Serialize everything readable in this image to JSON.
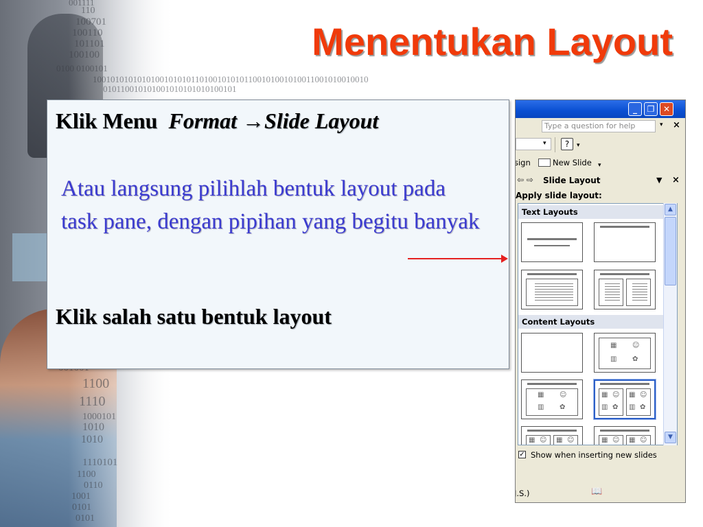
{
  "title": "Menentukan Layout",
  "binary_lines": [
    "001111",
    "110",
    "100701",
    "100110",
    "101101",
    "100100",
    "0100 0100101",
    "10010101010101001010101101001010101100101001010011001010010010",
    "010110010101001010101010100101",
    "001001",
    "1100",
    "1110",
    "1000101",
    "1010",
    "1010",
    "1110101",
    "1100",
    "0110",
    "1001",
    "0101",
    "0101"
  ],
  "instructions": {
    "line1_prefix": "Klik Menu",
    "line1_menu": "Format",
    "line1_arrow": "→",
    "line1_item": "Slide Layout",
    "paragraph": "Atau langsung pilihlah bentuk layout pada task pane, dengan pipihan yang begitu banyak",
    "line3": "Klik salah satu bentuk layout"
  },
  "colors": {
    "title": "#f03a0a",
    "paragraph": "#3b3bd0",
    "arrow": "#e52020",
    "titlebar": "#0a4fd2"
  },
  "window": {
    "buttons": {
      "minimize": "_",
      "restore": "❐",
      "close": "✕"
    },
    "help_placeholder": "Type a question for help",
    "help_dropdown": "▾",
    "help_close": "×",
    "combo_dropdown": "▾",
    "help_icon": "?",
    "help_icon_dropdown": "▾",
    "design_partial": "sign",
    "new_slide_label": "New Slide",
    "new_slide_dropdown": "▾",
    "status_text": "J.S.)",
    "status_icon": "📖"
  },
  "task_pane": {
    "nav_icons": "⇦ ⇨",
    "title": "Slide Layout",
    "dropdown": "▼",
    "close": "×",
    "apply_label": "Apply slide layout:",
    "sections": [
      {
        "label": "Text Layouts"
      },
      {
        "label": "Content Layouts"
      }
    ],
    "scroll_up": "▲",
    "scroll_down": "▼",
    "show_when_inserting": "Show when inserting new slides",
    "checkbox_checked": "✓"
  },
  "icons": {
    "table": "▦",
    "person": "☺",
    "chart": "▥",
    "diagram": "✿"
  }
}
